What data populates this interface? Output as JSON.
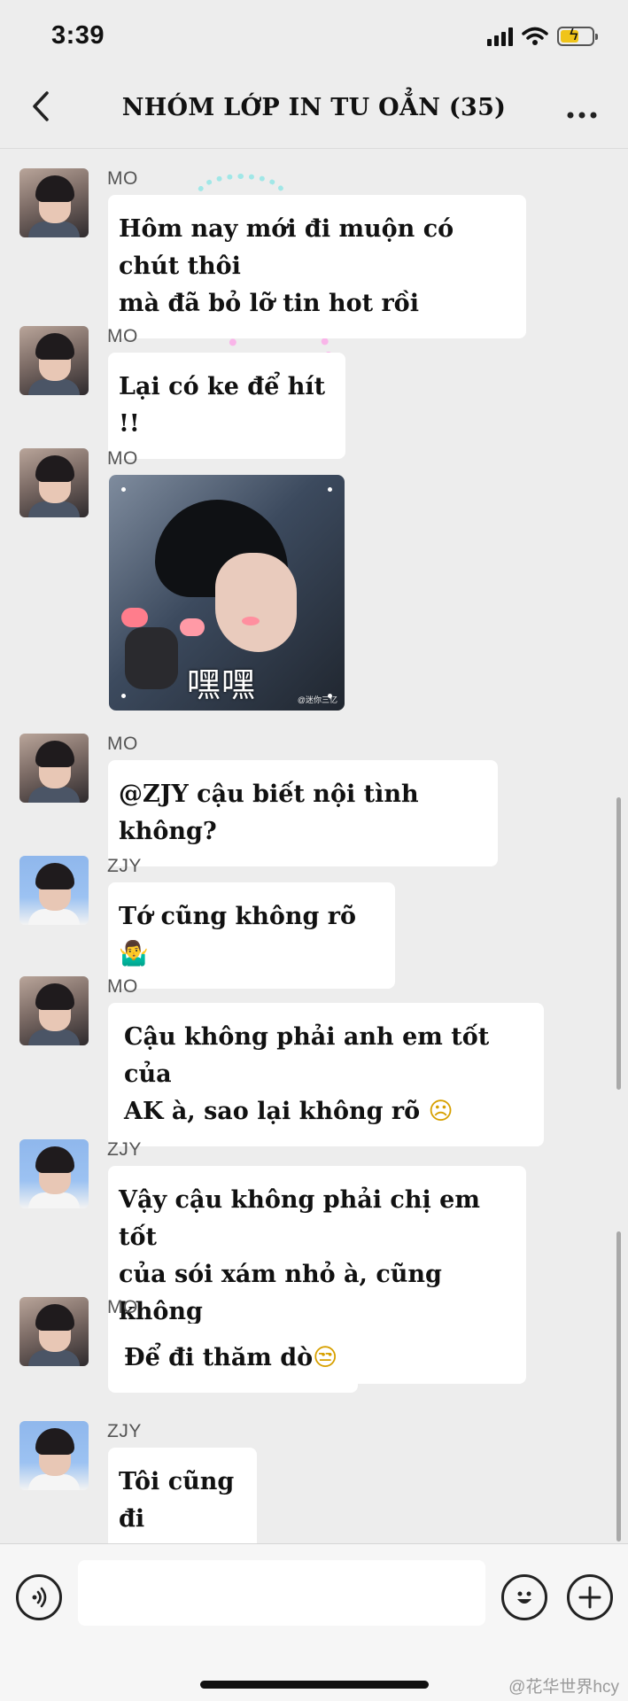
{
  "status_bar": {
    "time": "3:39"
  },
  "header": {
    "back_icon": "chevron-left-icon",
    "title": "NHÓM LỚP IN TU OẲN (35)",
    "more_icon": "ellipsis-icon"
  },
  "messages": [
    {
      "sender": "MO",
      "avatar": "mo",
      "text": "Hôm nay mới đi muộn có chút thôi\nmà đã bỏ lỡ tin hot rồi"
    },
    {
      "sender": "MO",
      "avatar": "mo",
      "text": "Lại có ke để hít !!"
    },
    {
      "sender": "MO",
      "avatar": "mo",
      "sticker_caption": "嘿嘿",
      "sticker_credit": "@迷你三亿"
    },
    {
      "sender": "MO",
      "avatar": "mo",
      "text": "@ZJY cậu biết nội tình không?"
    },
    {
      "sender": "ZJY",
      "avatar": "zjy",
      "text": "Tớ cũng không rõ",
      "emoji": "🤷‍♂️"
    },
    {
      "sender": "MO",
      "avatar": "mo",
      "text": "Cậu không phải anh em tốt của\nAK à, sao lại không rõ",
      "emoji": "☹"
    },
    {
      "sender": "ZJY",
      "avatar": "zjy",
      "text": "Vậy cậu không phải chị em tốt\ncủa sói xám nhỏ à, cũng không\nbiết còn gì"
    },
    {
      "sender": "MO",
      "avatar": "mo",
      "text": "Để đi thăm dò",
      "emoji": "😒"
    },
    {
      "sender": "ZJY",
      "avatar": "zjy",
      "text": "Tôi cũng đi"
    }
  ],
  "input_bar": {
    "voice_icon": "voice-icon",
    "emoji_icon": "smiley-icon",
    "plus_icon": "plus-icon",
    "placeholder": ""
  },
  "watermark": "@花华世界hcy",
  "colors": {
    "background": "#ededed",
    "bubble": "#ffffff",
    "text": "#111111"
  }
}
